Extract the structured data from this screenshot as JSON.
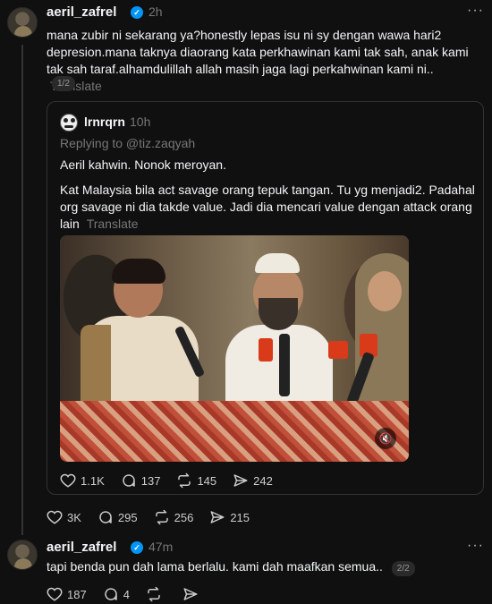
{
  "post1": {
    "username": "aeril_zafrel",
    "time": "2h",
    "text": "mana zubir ni sekarang ya?honestly lepas isu ni sy dengan wawa hari2 depresion.mana taknya diaorang kata perkhawinan kami tak sah, anak kami tak sah taraf.alhamdulillah allah masih jaga lagi perkahwinan kami ni..",
    "translate": "Translate",
    "page_badge": "1/2",
    "stats": {
      "likes": "3K",
      "comments": "295",
      "reposts": "256",
      "shares": "215"
    }
  },
  "quote": {
    "username": "lrnrqrn",
    "time": "10h",
    "replying_to": "Replying to @tiz.zaqyah",
    "line1": "Aeril kahwin. Nonok meroyan.",
    "line2": "Kat Malaysia bila act savage orang tepuk tangan. Tu yg menjadi2. Padahal org savage ni dia takde value. Jadi dia mencari value dengan attack orang lain",
    "translate": "Translate",
    "stats": {
      "likes": "1.1K",
      "comments": "137",
      "reposts": "145",
      "shares": "242"
    }
  },
  "post2": {
    "username": "aeril_zafrel",
    "time": "47m",
    "text": "tapi benda pun dah lama berlalu. kami dah maafkan semua..",
    "page_badge": "2/2",
    "stats": {
      "likes": "187",
      "comments": "4"
    }
  },
  "icons": {
    "verified": "verified-check-icon",
    "more": "more-dots-icon",
    "heart": "heart-icon",
    "comment": "comment-icon",
    "repost": "repost-icon",
    "share": "share-icon",
    "mute": "muted-speaker-icon"
  },
  "colors": {
    "background": "#101010",
    "verified": "#0095f6",
    "muted_text": "#777777"
  }
}
